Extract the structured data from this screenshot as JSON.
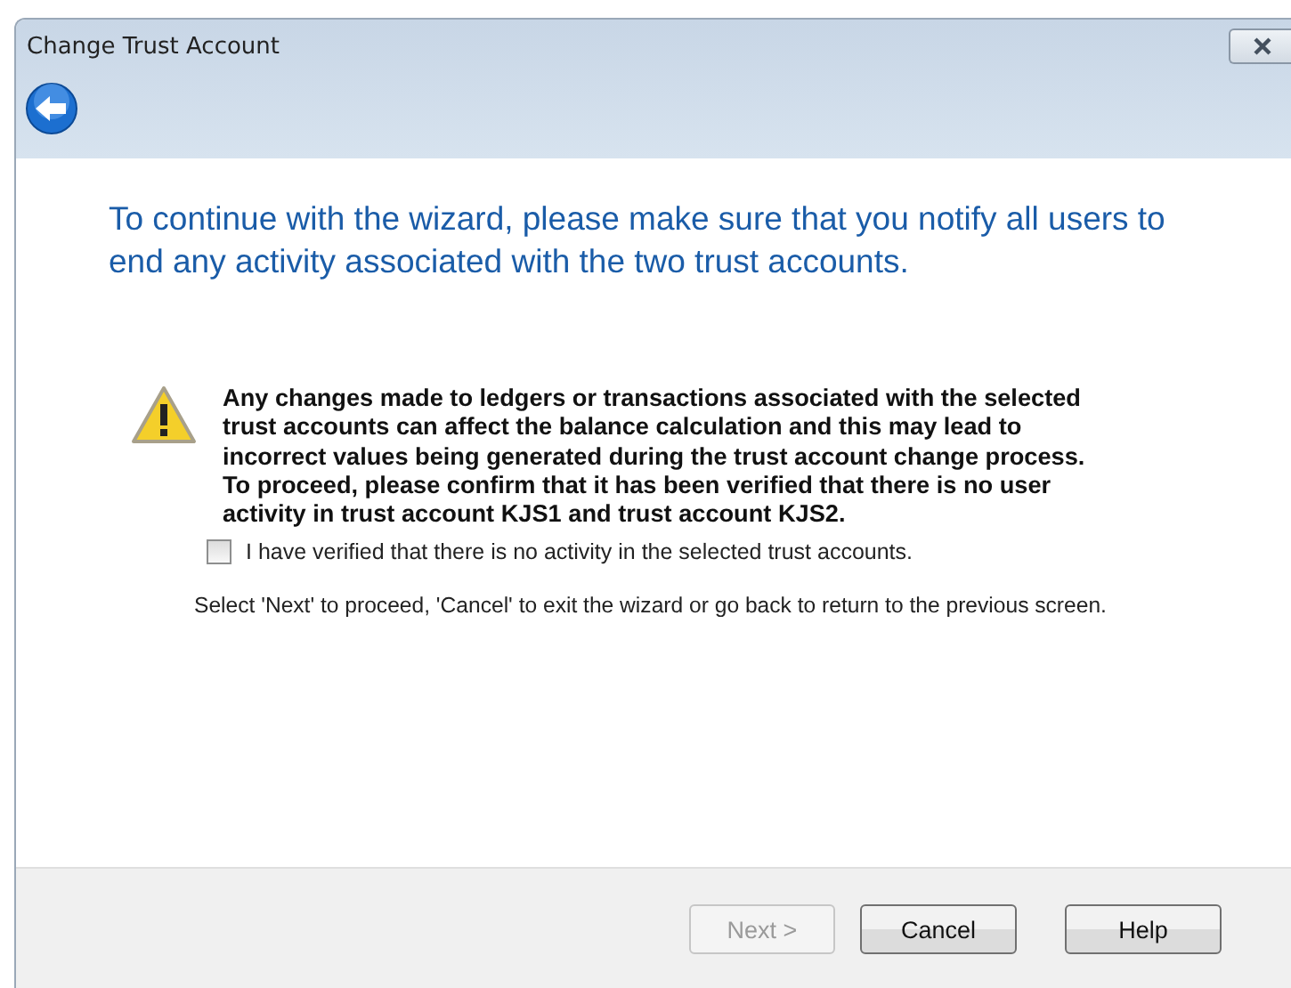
{
  "window": {
    "title": "Change Trust Account"
  },
  "heading": "To continue with the wizard, please make sure that you notify all users to end any activity associated with the two trust accounts.",
  "warning": {
    "paragraphs": [
      "Any changes made to ledgers or transactions associated with the selected trust accounts can affect the balance calculation and this may lead to incorrect values being generated during the trust account change process.",
      "To proceed, please confirm that it has been verified that there is no user activity in trust account KJS1 and trust account KJS2."
    ]
  },
  "confirm": {
    "label": "I have verified that there is no activity in the selected trust accounts.",
    "checked": false
  },
  "instructions": "Select 'Next' to proceed, 'Cancel' to exit the wizard or go back to return to the previous screen.",
  "buttons": [
    {
      "label": "Next >",
      "disabled": true
    },
    {
      "label": "Cancel",
      "disabled": false
    },
    {
      "label": "Help",
      "disabled": false
    }
  ]
}
